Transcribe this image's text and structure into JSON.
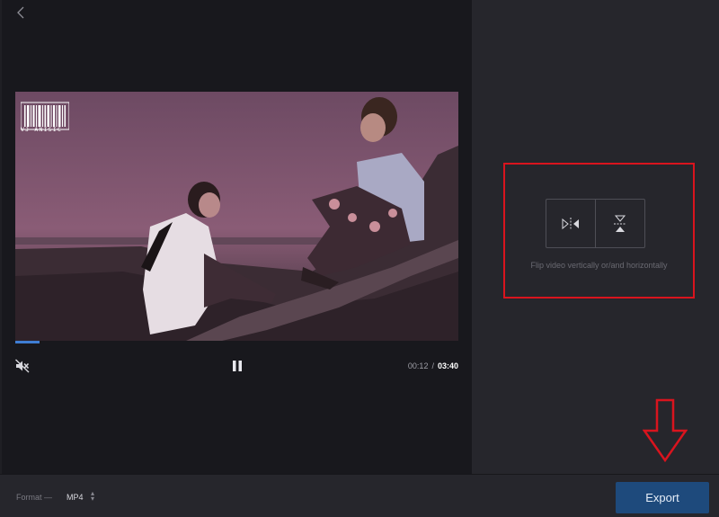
{
  "player": {
    "watermark_text": "VJ ANISIC",
    "current_time": "00:12",
    "separator": "/",
    "total_time": "03:40",
    "progress_fraction": 0.055
  },
  "flip": {
    "caption": "Flip video vertically or/and horizontally"
  },
  "bottom_bar": {
    "format_label": "Format —",
    "format_value": "MP4",
    "export_label": "Export"
  },
  "colors": {
    "accent": "#3f7ed4",
    "export_button": "#1e4a7c",
    "annotation_red": "#d9141e"
  },
  "icons": {
    "back": "chevron-left-icon",
    "mute": "speaker-muted-icon",
    "pause": "pause-icon",
    "flip_horizontal": "flip-horizontal-icon",
    "flip_vertical": "flip-vertical-icon",
    "stepper": "up-down-chevron-icon"
  }
}
